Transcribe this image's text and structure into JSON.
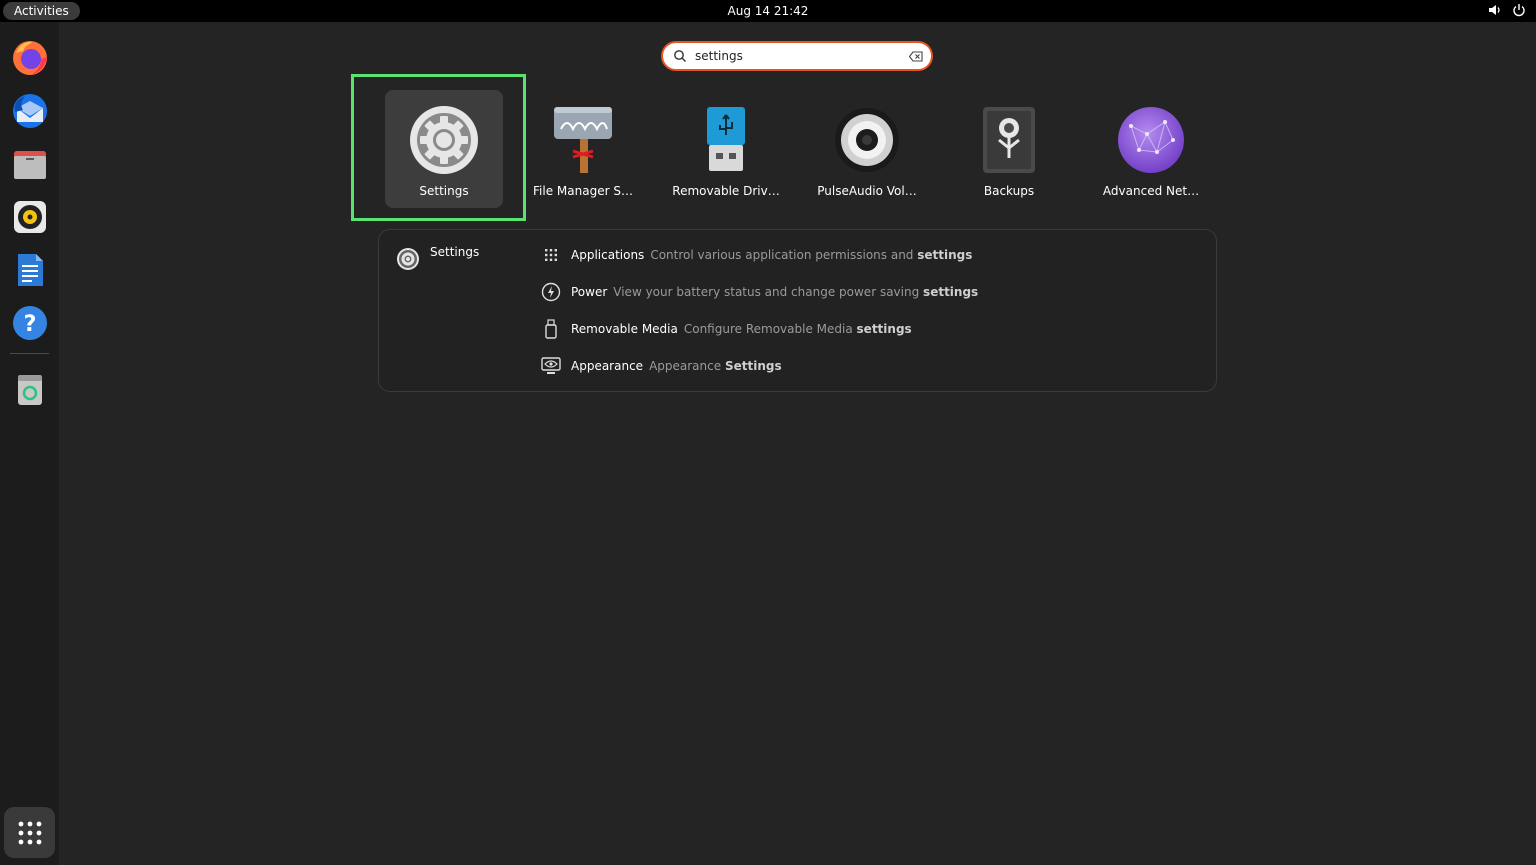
{
  "topbar": {
    "activities_label": "Activities",
    "clock": "Aug 14  21:42"
  },
  "dock": {
    "items": [
      "firefox-icon",
      "thunderbird-icon",
      "files-icon",
      "rhythmbox-icon",
      "writer-icon",
      "help-icon",
      "trash-icon"
    ],
    "show_apps": "grid-icon"
  },
  "search": {
    "value": "settings"
  },
  "apps": [
    {
      "label": "Settings",
      "icon": "settings-gear-icon",
      "selected": true
    },
    {
      "label": "File Manager S…",
      "icon": "file-manager-settings-icon"
    },
    {
      "label": "Removable Driv…",
      "icon": "usb-drive-icon"
    },
    {
      "label": "PulseAudio Vol…",
      "icon": "speaker-icon"
    },
    {
      "label": "Backups",
      "icon": "backups-safe-icon"
    },
    {
      "label": "Advanced Net…",
      "icon": "network-globe-icon"
    }
  ],
  "provider": {
    "name": "Settings",
    "results": [
      {
        "title": "Applications",
        "desc": "Control various application permissions and",
        "match": "settings",
        "icon": "apps-grid-icon"
      },
      {
        "title": "Power",
        "desc": "View your battery status and change power saving",
        "match": "settings",
        "icon": "power-icon"
      },
      {
        "title": "Removable Media",
        "desc": "Configure Removable Media",
        "match": "settings",
        "icon": "removable-media-icon"
      },
      {
        "title": "Appearance",
        "desc": "Appearance",
        "match": "Settings",
        "icon": "appearance-icon"
      }
    ]
  },
  "colors": {
    "accent": "#e95420",
    "highlight": "#57e36d",
    "background": "#242424"
  }
}
